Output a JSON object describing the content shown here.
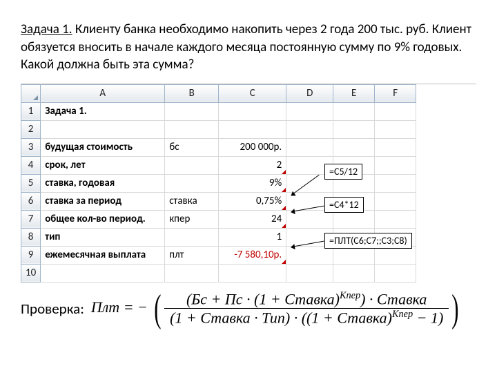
{
  "task": {
    "label": "Задача 1.",
    "body": " Клиенту банка необходимо накопить  через 2 года 200 тыс. руб. Клиент обязуется вносить в начале каждого месяца постоянную сумму по 9% годовых. Какой должна быть эта сумма?"
  },
  "sheet": {
    "columns": [
      "A",
      "B",
      "C",
      "D",
      "E",
      "F"
    ],
    "rows": [
      {
        "n": "1",
        "A": "Задача 1.",
        "bold": true
      },
      {
        "n": "2"
      },
      {
        "n": "3",
        "A": "будущая стоимость",
        "bold": true,
        "B": "бс",
        "C": "200 000р.",
        "alignC": "right"
      },
      {
        "n": "4",
        "A": "срок, лет",
        "bold": true,
        "C": "2",
        "alignC": "right",
        "tri": true
      },
      {
        "n": "5",
        "A": "ставка, годовая",
        "bold": true,
        "C": "9%",
        "alignC": "right",
        "tri": true
      },
      {
        "n": "6",
        "A": "ставка за период",
        "bold": true,
        "B": "ставка",
        "C": "0,75%",
        "alignC": "right",
        "tri": true
      },
      {
        "n": "7",
        "A": "общее кол-во период.",
        "bold": true,
        "B": "кпер",
        "C": "24",
        "alignC": "right",
        "tri": true
      },
      {
        "n": "8",
        "A": "тип",
        "bold": true,
        "C": "1",
        "alignC": "right"
      },
      {
        "n": "9",
        "A": "ежемесячная выплата",
        "bold": true,
        "B": "плт",
        "C": "-7 580,10р.",
        "alignC": "right",
        "red": true,
        "tri": true
      },
      {
        "n": "10"
      }
    ]
  },
  "callouts": {
    "c1": "=C5/12",
    "c2": "=C4*12",
    "c3": "=ПЛТ(C6;C7;;C3;C8)"
  },
  "check": {
    "label": "Проверка:",
    "plt": "Плт",
    "eq": " = − ",
    "num": "(Бс + Пс · (1 + Ставка)<sup>Кпер</sup>) · Ставка",
    "den": "(1 + Ставка · Тип) · ((1 + Ставка)<sup>Кпер</sup> − 1)"
  }
}
